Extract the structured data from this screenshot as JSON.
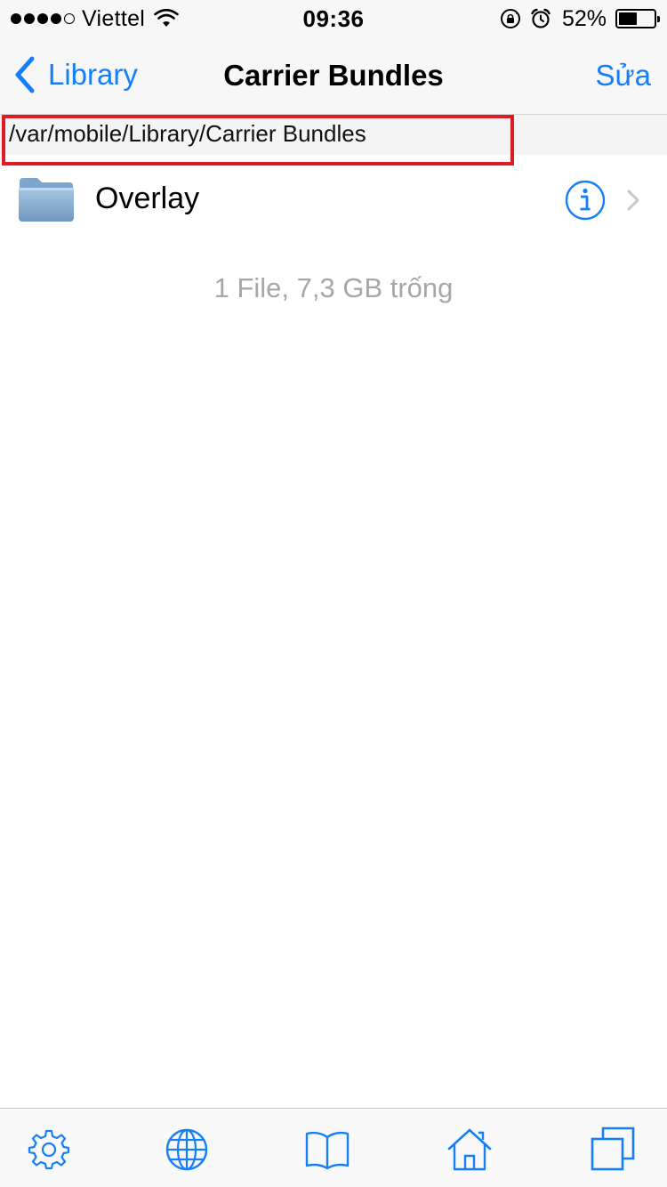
{
  "status_bar": {
    "carrier": "Viettel",
    "signal_bars": 4,
    "signal_max": 5,
    "time": "09:36",
    "battery_percent": "52%",
    "battery_level": 0.52,
    "icons": [
      "wifi-icon",
      "orientation-lock-icon",
      "alarm-icon",
      "battery-icon"
    ]
  },
  "nav": {
    "back_label": "Library",
    "title": "Carrier Bundles",
    "edit_label": "Sửa"
  },
  "path": "/var/mobile/Library/Carrier Bundles",
  "files": [
    {
      "name": "Overlay",
      "icon": "folder-icon"
    }
  ],
  "summary": "1 File, 7,3 GB trống",
  "toolbar": {
    "items": [
      "settings-icon",
      "globe-icon",
      "book-icon",
      "home-icon",
      "windows-icon"
    ]
  },
  "colors": {
    "accent": "#147efb",
    "highlight": "#e11b26",
    "muted_text": "#a7a7a7"
  }
}
